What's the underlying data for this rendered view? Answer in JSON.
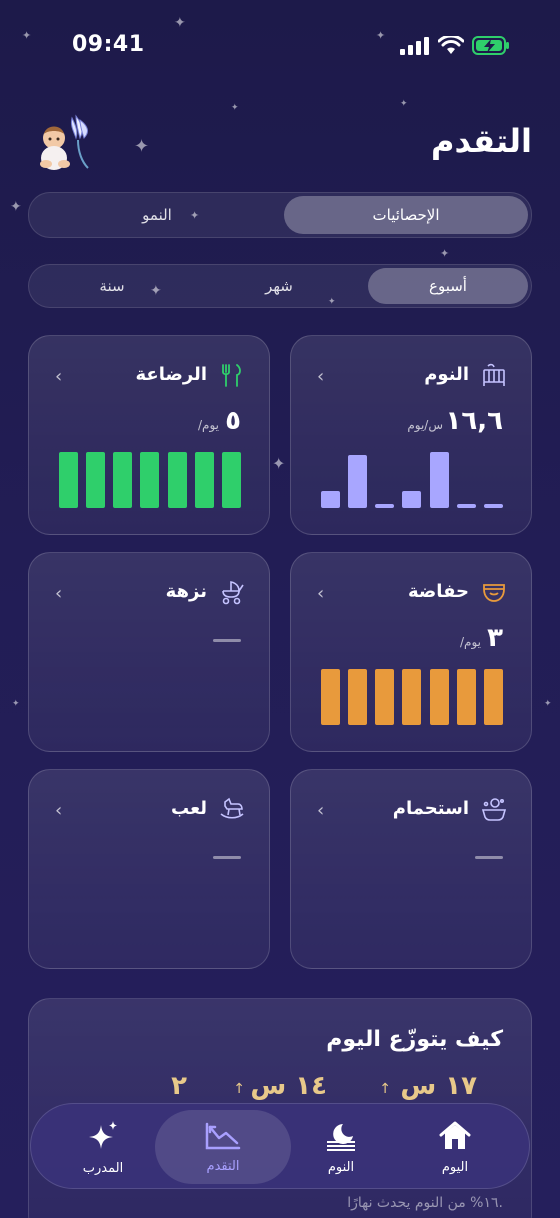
{
  "status_bar": {
    "time": "09:41"
  },
  "header": {
    "title": "التقدم"
  },
  "primary_tabs": [
    {
      "label": "الإحصائيات",
      "active": true
    },
    {
      "label": "النمو",
      "active": false
    }
  ],
  "period_tabs": [
    {
      "label": "أسبوع",
      "active": true
    },
    {
      "label": "شهر",
      "active": false
    },
    {
      "label": "سنة",
      "active": false
    }
  ],
  "cards": {
    "sleep": {
      "title": "النوم",
      "icon": "crib-icon",
      "value": "١٦,٦",
      "unit": "س/يوم",
      "bars": [
        0.3,
        0.95,
        0.08,
        0.3,
        1.0,
        0.06,
        0.06
      ],
      "color": "#a8a6ff"
    },
    "feeding": {
      "title": "الرضاعة",
      "icon": "fork-knife-icon",
      "value": "٥",
      "unit": "/يوم",
      "bars": [
        1,
        1,
        1,
        1,
        1,
        1,
        1
      ],
      "color": "#2fcf6b"
    },
    "diaper": {
      "title": "حفاضة",
      "icon": "diaper-icon",
      "value": "٣",
      "unit": "/يوم",
      "bars": [
        1,
        1,
        1,
        1,
        1,
        1,
        1
      ],
      "color": "#e89a3c"
    },
    "walk": {
      "title": "نزهة",
      "icon": "stroller-icon"
    },
    "bath": {
      "title": "استحمام",
      "icon": "bath-icon"
    },
    "play": {
      "title": "لعب",
      "icon": "rocking-horse-icon"
    }
  },
  "distribution": {
    "title": "كيف يتوزّع اليوم",
    "stats": [
      {
        "value": "١٧ س",
        "arrow": "↑"
      },
      {
        "value": "١٤ س",
        "arrow": "↑"
      },
      {
        "value": "٢",
        "arrow": ""
      }
    ],
    "note": "١٦% من النوم يحدث نهارًا."
  },
  "tabbar": [
    {
      "label": "اليوم",
      "icon": "home-icon",
      "active": false
    },
    {
      "label": "النوم",
      "icon": "moon-icon",
      "active": false
    },
    {
      "label": "التقدم",
      "icon": "chart-icon",
      "active": true
    },
    {
      "label": "المدرب",
      "icon": "sparkles-icon",
      "active": false
    }
  ],
  "colors": {
    "background": "#221d55",
    "sleep": "#a8a6ff",
    "feeding": "#2fcf6b",
    "diaper": "#e89a3c",
    "accent": "#a9a0ff"
  }
}
